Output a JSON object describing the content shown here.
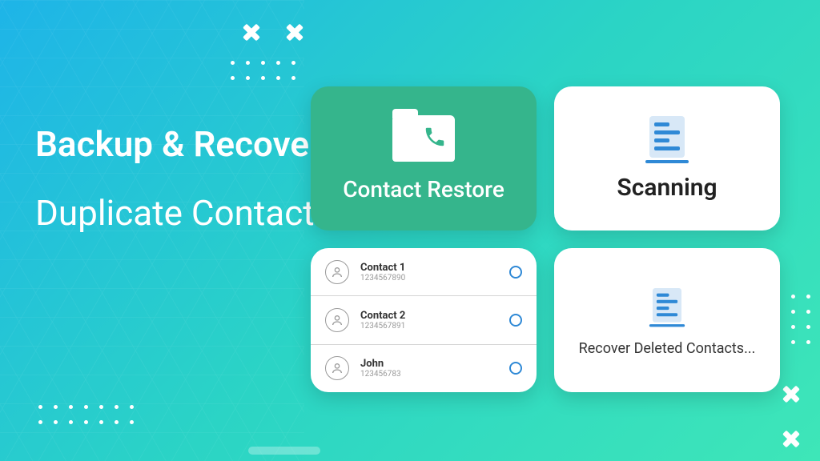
{
  "headline1": "Backup & Recover Contact",
  "headline2": "Duplicate Contact Fixer",
  "cards": {
    "restore": {
      "label": "Contact Restore"
    },
    "scanning": {
      "label": "Scanning"
    },
    "recover": {
      "label": "Recover Deleted Contacts..."
    }
  },
  "contacts": [
    {
      "name": "Contact 1",
      "number": "1234567890"
    },
    {
      "name": "Contact 2",
      "number": "1234567891"
    },
    {
      "name": "John",
      "number": "123456783"
    }
  ]
}
